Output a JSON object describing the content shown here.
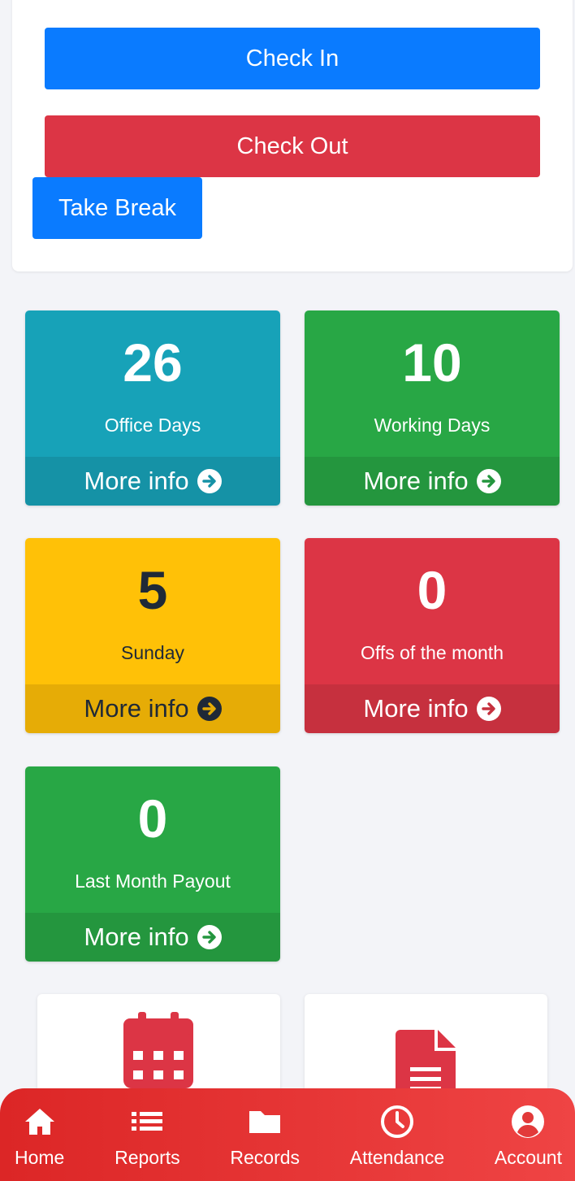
{
  "actions": {
    "check_in": "Check In",
    "check_out": "Check Out",
    "take_break": "Take Break"
  },
  "stats": [
    {
      "value": "26",
      "label": "Office Days",
      "more": "More info",
      "color": "#17a2b8",
      "footer_color": "#1592a6",
      "text_color": "#ffffff"
    },
    {
      "value": "10",
      "label": "Working Days",
      "more": "More info",
      "color": "#28a745",
      "footer_color": "#24963e",
      "text_color": "#ffffff"
    },
    {
      "value": "5",
      "label": "Sunday",
      "more": "More info",
      "color": "#ffc107",
      "footer_color": "#e6ac06",
      "text_color": "#1f2937"
    },
    {
      "value": "0",
      "label": "Offs of the month",
      "more": "More info",
      "color": "#dc3545",
      "footer_color": "#c6303e",
      "text_color": "#ffffff"
    },
    {
      "value": "0",
      "label": "Last Month Payout",
      "more": "More info",
      "color": "#28a745",
      "footer_color": "#24963e",
      "text_color": "#ffffff"
    }
  ],
  "quick_links": [
    {
      "icon": "calendar-icon"
    },
    {
      "icon": "document-icon"
    }
  ],
  "nav": [
    {
      "label": "Home",
      "icon": "home-icon"
    },
    {
      "label": "Reports",
      "icon": "list-icon"
    },
    {
      "label": "Records",
      "icon": "folder-icon"
    },
    {
      "label": "Attendance",
      "icon": "clock-icon"
    },
    {
      "label": "Account",
      "icon": "user-circle-icon"
    }
  ],
  "colors": {
    "primary": "#0a7bff",
    "danger": "#dc3545",
    "nav_gradient_start": "#dc2626",
    "nav_gradient_end": "#ef4444"
  }
}
